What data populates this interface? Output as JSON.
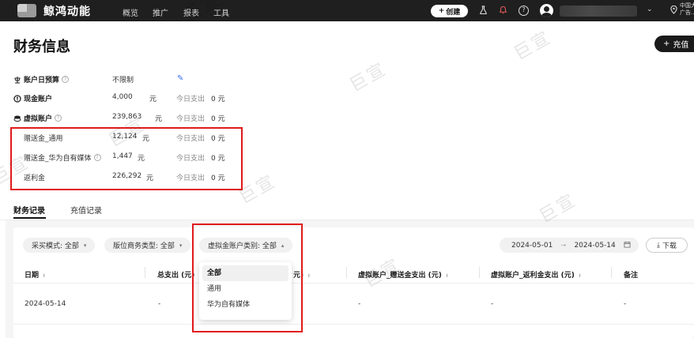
{
  "topbar": {
    "brand": "鲸鸿动能",
    "nav": [
      "概览",
      "推广",
      "报表",
      "工具"
    ],
    "create_label": "创建",
    "region": [
      "中国大",
      "广告..."
    ]
  },
  "page": {
    "title": "财务信息",
    "recharge_label": "充值"
  },
  "accounts": [
    {
      "label": "账户日预算",
      "value": "不限制",
      "unit": "",
      "today_label": "",
      "today_value": ""
    },
    {
      "label": "现金账户",
      "value": "4,000",
      "unit": "元",
      "today_label": "今日支出",
      "today_value": "0 元"
    },
    {
      "label": "虚拟账户",
      "value": "239,863",
      "unit": "元",
      "today_label": "今日支出",
      "today_value": "0 元"
    },
    {
      "label": "赠送金_通用",
      "value": "12,124",
      "unit": "元",
      "today_label": "今日支出",
      "today_value": "0 元"
    },
    {
      "label": "赠送金_华为自有媒体",
      "value": "1,447",
      "unit": "元",
      "today_label": "今日支出",
      "today_value": "0 元"
    },
    {
      "label": "返利金",
      "value": "226,292",
      "unit": "元",
      "today_label": "今日支出",
      "today_value": "0 元"
    }
  ],
  "tabs": [
    "财务记录",
    "充值记录"
  ],
  "filters": {
    "purchase_mode": "采买模式: 全部",
    "business_type": "版位商务类型: 全部",
    "virtual_type": "虚拟金账户类别: 全部",
    "date_start": "2024-05-01",
    "date_end": "2024-05-14",
    "download_label": "下载"
  },
  "dropdown": {
    "options": [
      "全部",
      "通用",
      "华为自有媒体"
    ],
    "selected": "全部"
  },
  "table": {
    "headers": [
      "日期",
      "总支出 (元)",
      "元)",
      "虚拟账户_赠送金支出 (元)",
      "虚拟账户_返利金支出 (元)",
      "备注"
    ],
    "rows": [
      [
        "2024-05-14",
        "-",
        "-",
        "-",
        "-",
        "-"
      ]
    ]
  },
  "watermark": "巨宣",
  "colors": {
    "topbar": "#1f1f1f",
    "highlight_box": "#e01a1a",
    "edit_icon": "#3a6df0"
  }
}
